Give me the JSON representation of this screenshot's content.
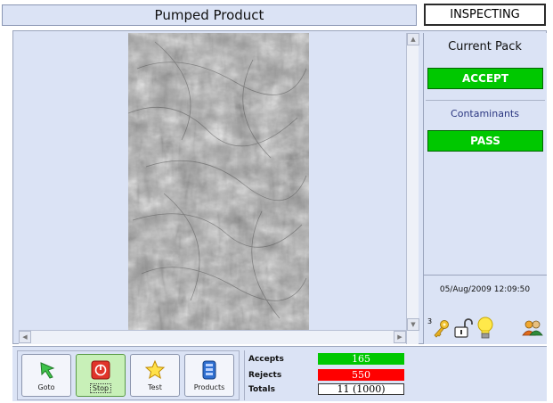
{
  "header": {
    "title": "Pumped Product",
    "status": "INSPECTING"
  },
  "right_panel": {
    "heading": "Current Pack",
    "pack_result": "ACCEPT",
    "contaminants_label": "Contaminants",
    "contaminants_result": "PASS",
    "datetime": "05/Aug/2009 12:09:50",
    "key_level": "3"
  },
  "toolbar": {
    "goto_label": "Goto",
    "stop_label": "Stop",
    "test_label": "Test",
    "products_label": "Products"
  },
  "counts": {
    "accepts_label": "Accepts",
    "accepts_value": "165",
    "rejects_label": "Rejects",
    "rejects_value": "550",
    "totals_label": "Totals",
    "totals_value": "11 (1000)"
  },
  "colors": {
    "pass_green": "#00c800",
    "reject_red": "#ff0000",
    "panel_bg": "#dbe3f5"
  },
  "icons": {
    "goto": "green-arrow-icon",
    "stop": "stop-icon",
    "test": "star-icon",
    "products": "products-icon",
    "key": "key-icon",
    "lock": "unlock-icon",
    "bulb": "lightbulb-icon",
    "users": "users-icon"
  }
}
